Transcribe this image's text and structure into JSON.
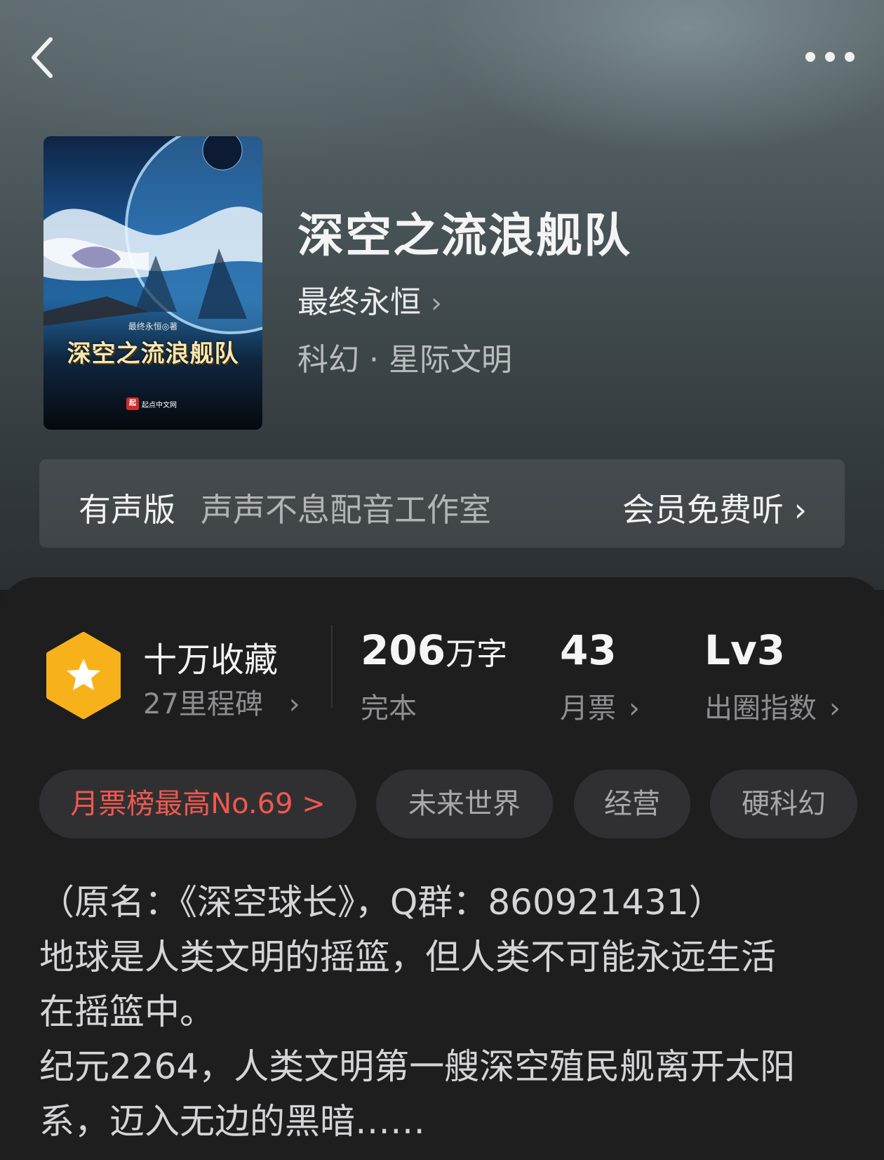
{
  "nav": {
    "back_icon": "chevron-left-icon",
    "more_icon": "more-dots-icon"
  },
  "cover": {
    "title": "深空之流浪舰队",
    "author_line": "最终永恒◎著",
    "publisher": "起点中文网",
    "publisher_logo": "起"
  },
  "book": {
    "title": "深空之流浪舰队",
    "author": "最终永恒",
    "genre": "科幻 · 星际文明"
  },
  "audio": {
    "label": "有声版",
    "studio": "声声不息配音工作室",
    "action": "会员免费听"
  },
  "stats": {
    "collection_title": "十万收藏",
    "milestones": "27里程碑",
    "words_value": "206",
    "words_unit": "万字",
    "words_label": "完本",
    "monthly_votes_value": "43",
    "monthly_votes_label": "月票",
    "index_value": "Lv3",
    "index_label": "出圈指数"
  },
  "tags": [
    "月票榜最高No.69 >",
    "未来世界",
    "经营",
    "硬科幻"
  ],
  "description": [
    "（原名：《深空球长》，Q群：860921431）",
    "地球是人类文明的摇篮，但人类不可能永远生活",
    "在摇篮中。",
    "纪元2264，人类文明第一艘深空殖民舰离开太阳",
    "系，迈入无边的黑暗……"
  ],
  "colors": {
    "accent_red": "#f0584f",
    "badge_orange": "#f7b21b",
    "panel_bg": "#1e1e1f"
  }
}
